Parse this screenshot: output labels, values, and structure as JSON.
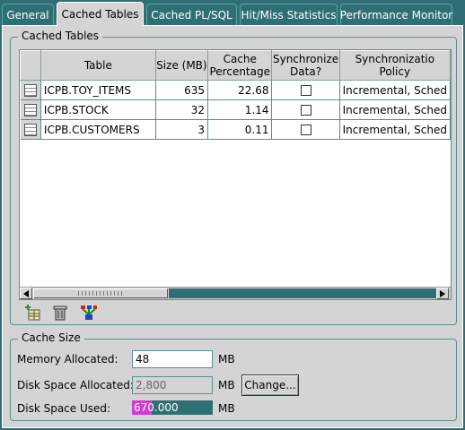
{
  "tabs": [
    {
      "label": "General",
      "active": false
    },
    {
      "label": "Cached Tables",
      "active": true
    },
    {
      "label": "Cached PL/SQL",
      "active": false
    },
    {
      "label": "Hit/Miss Statistics",
      "active": false
    },
    {
      "label": "Performance Monitor",
      "active": false
    }
  ],
  "cached_tables": {
    "legend": "Cached Tables",
    "columns": [
      "Table",
      "Size (MB)",
      "Cache\nPercentage",
      "Synchronize\nData?",
      "Synchronizatio\nPolicy"
    ],
    "rows": [
      {
        "table": "ICPB.TOY_ITEMS",
        "size": "635",
        "cache_pct": "22.68",
        "sync": false,
        "policy": "Incremental, Sched"
      },
      {
        "table": "ICPB.STOCK",
        "size": "32",
        "cache_pct": "1.14",
        "sync": false,
        "policy": "Incremental, Sched"
      },
      {
        "table": "ICPB.CUSTOMERS",
        "size": "3",
        "cache_pct": "0.11",
        "sync": false,
        "policy": "Incremental, Sched"
      }
    ],
    "actions": [
      {
        "name": "add-table-icon"
      },
      {
        "name": "trash-icon"
      },
      {
        "name": "synchronize-icon"
      }
    ]
  },
  "cache_size": {
    "legend": "Cache Size",
    "memory_label": "Memory Allocated:",
    "memory_value": "48",
    "memory_unit": "MB",
    "disk_alloc_label": "Disk Space Allocated:",
    "disk_alloc_value": "2,800",
    "disk_alloc_unit": "MB",
    "change_label": "Change...",
    "disk_used_label": "Disk Space Used:",
    "disk_used_value": "670.000",
    "disk_used_unit": "MB",
    "disk_used_fraction": 0.24
  },
  "colors": {
    "background": "#2f6f73",
    "panel": "#d4d4d4",
    "usage_fill": "#d43ad8"
  }
}
